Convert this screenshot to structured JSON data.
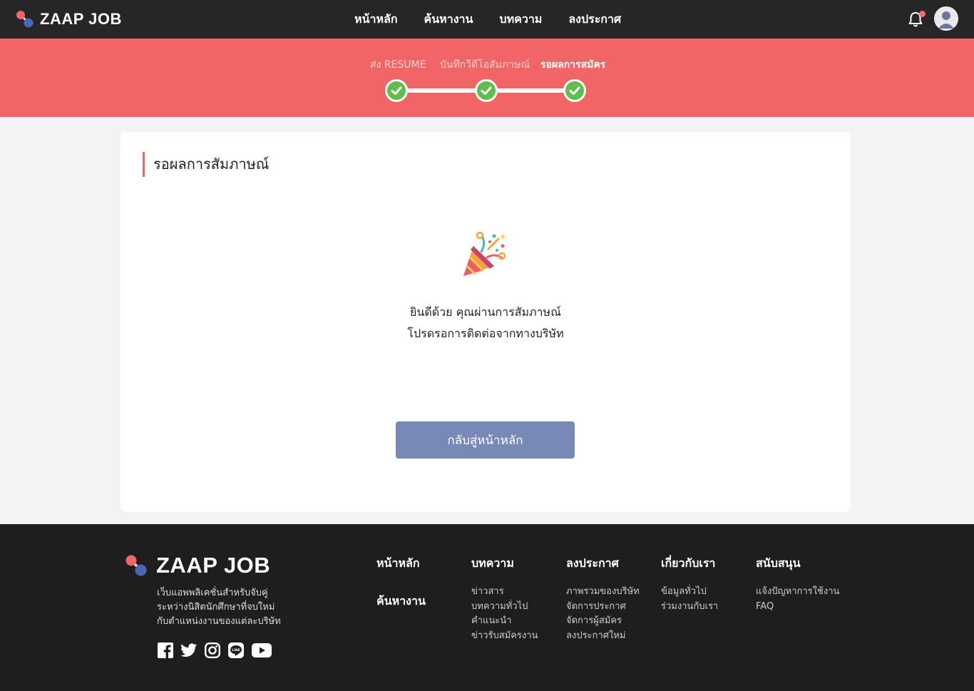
{
  "colors": {
    "topbar": "#262626",
    "accent": "#f26566",
    "success": "#5fbe4c",
    "button": "#7889b8",
    "footer": "#1e1e1e"
  },
  "header": {
    "brand": "ZAAP JOB",
    "nav": [
      "หน้าหลัก",
      "ค้นหางาน",
      "บทความ",
      "ลงประกาศ"
    ],
    "notification_icon": "bell-icon",
    "avatar_icon": "user-avatar-icon"
  },
  "progress": {
    "steps": [
      {
        "label": "ส่ง RESUME",
        "status": "done"
      },
      {
        "label": "บันทึกวีดีโอสัมภาษณ์",
        "status": "done"
      },
      {
        "label": "รอผลการสมัคร",
        "status": "active"
      }
    ]
  },
  "main": {
    "title": "รอผลการสัมภาษณ์",
    "icon": "party-popper-icon",
    "message_line1": "ยินดีด้วย คุณผ่านการสัมภาษณ์",
    "message_line2": "โปรดรอการติดต่อจากทางบริษัท",
    "button_label": "กลับสู่หน้าหลัก"
  },
  "footer": {
    "brand": "ZAAP JOB",
    "description": [
      "เว็บแอพพลิเคชั่นสำหรับจับคู่",
      "ระหว่างนิสิตนักศึกษาที่จบใหม่",
      "กับตำแหน่งงานของแต่ละบริษัท"
    ],
    "social": [
      "facebook-icon",
      "twitter-icon",
      "instagram-icon",
      "line-icon",
      "youtube-icon"
    ],
    "col_home": {
      "heading1": "หน้าหลัก",
      "heading2": "ค้นหางาน"
    },
    "columns": [
      {
        "heading": "บทความ",
        "links": [
          "ข่าวสาร",
          "บทความทั่วไป",
          "คำแนะนำ",
          "ข่าวรับสมัครงาน"
        ]
      },
      {
        "heading": "ลงประกาศ",
        "links": [
          "ภาพรวมของบริษัท",
          "จัดการประกาศ",
          "จัดการผู้สมัคร",
          "ลงประกาศใหม่"
        ]
      },
      {
        "heading": "เกี่ยวกับเรา",
        "links": [
          "ข้อมูลทั่วไป",
          "ร่วมงานกับเรา"
        ]
      },
      {
        "heading": "สนับสนุน",
        "links": [
          "แจ้งปัญหาการใช้งาน",
          "FAQ"
        ]
      }
    ]
  }
}
